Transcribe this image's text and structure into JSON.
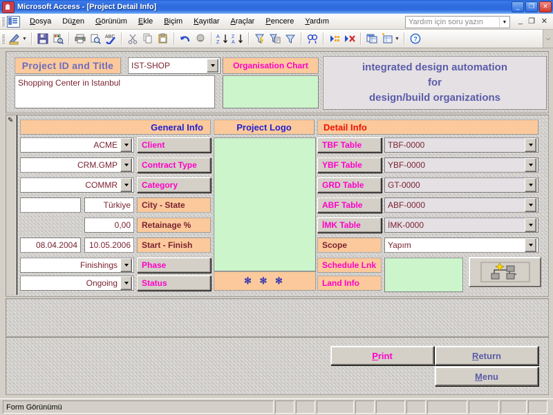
{
  "window": {
    "title": "Microsoft Access - [Project Detail Info]",
    "app_icon": "access-key-icon",
    "minimize": "_",
    "restore": "❐",
    "close": "✕"
  },
  "menubar": {
    "items": [
      {
        "label": "Dosya",
        "accel": "D"
      },
      {
        "label": "Düzen",
        "accel": "z"
      },
      {
        "label": "Görünüm",
        "accel": "G"
      },
      {
        "label": "Ekle",
        "accel": "E"
      },
      {
        "label": "Biçim",
        "accel": "B"
      },
      {
        "label": "Kayıtlar",
        "accel": "K"
      },
      {
        "label": "Araçlar",
        "accel": "A"
      },
      {
        "label": "Pencere",
        "accel": "P"
      },
      {
        "label": "Yardım",
        "accel": "Y"
      }
    ],
    "ask_box": {
      "placeholder": "Yardım için soru yazın",
      "value": "Yardım için soru yazın"
    },
    "doc_minimize": "_",
    "doc_restore": "❐",
    "doc_close": "✕"
  },
  "toolbar": {
    "buttons": [
      "view-design-icon",
      "view-dropdown-caret",
      "save-icon",
      "print-preview-icon",
      "print-icon",
      "preview-icon",
      "spelling-icon",
      "cut-icon",
      "copy-icon",
      "paste-icon",
      "undo-icon",
      "insert-hyperlink-icon",
      "sort-ascending-icon",
      "sort-descending-icon",
      "filter-by-selection-icon",
      "filter-by-form-icon",
      "apply-filter-icon",
      "find-icon",
      "new-record-icon",
      "delete-record-icon",
      "database-window-icon",
      "new-object-icon",
      "new-object-caret",
      "help-icon"
    ],
    "overflow": "⌵"
  },
  "form": {
    "header": {
      "title_label": "Project ID and Title",
      "project_id": "IST-SHOP",
      "org_chart_label": "Organisation Chart",
      "description": "Shopping Center in Istanbul",
      "tagline": [
        "integrated design automation",
        "for",
        "design/build organizations"
      ]
    },
    "sections": {
      "general_info": "General Info",
      "project_logo": "Project Logo",
      "detail_info": "Detail Info"
    },
    "general_rows": [
      {
        "value": "ACME",
        "label": "Client",
        "style": "raised",
        "dropdown": true,
        "pair": false
      },
      {
        "value": "CRM.GMP",
        "label": "Contract Type",
        "style": "raised",
        "dropdown": true,
        "pair": false
      },
      {
        "value": "COMMR",
        "label": "Category",
        "style": "raised",
        "dropdown": true,
        "pair": false
      },
      {
        "value": "Türkiye",
        "label": "City - State",
        "style": "orange",
        "dropdown": false,
        "pair": true,
        "pair_value": ""
      },
      {
        "value": "0,00",
        "label": "Retainage %",
        "style": "orange",
        "dropdown": false,
        "pair": false
      },
      {
        "value": "10.05.2006",
        "label": "Start - Finish",
        "style": "orange",
        "dropdown": false,
        "pair": true,
        "pair_value": "08.04.2004"
      },
      {
        "value": "Finishings",
        "label": "Phase",
        "style": "raised",
        "dropdown": true,
        "pair": false
      },
      {
        "value": "Ongoing",
        "label": "Status",
        "style": "raised",
        "dropdown": true,
        "pair": false
      }
    ],
    "logo": {
      "stars": "✻ ✻ ✻"
    },
    "detail_rows": [
      {
        "label": "TBF Table",
        "style": "raised",
        "value": "TBF-0000",
        "field": "combo-gray"
      },
      {
        "label": "YBF Table",
        "style": "raised",
        "value": "YBF-0000",
        "field": "combo-gray"
      },
      {
        "label": "GRD Table",
        "style": "raised",
        "value": "GT-0000",
        "field": "combo-gray"
      },
      {
        "label": "ABF Table",
        "style": "raised",
        "value": "ABF-0000",
        "field": "combo-gray"
      },
      {
        "label": "İMK Table",
        "style": "raised",
        "value": "İMK-0000",
        "field": "combo-gray"
      },
      {
        "label": "Scope",
        "style": "orange",
        "value": "Yapım",
        "field": "combo-white"
      },
      {
        "label": "Schedule Lnk",
        "style": "orange",
        "value": "",
        "field": "green"
      },
      {
        "label": "Land Info",
        "style": "orange",
        "value": "",
        "field": "green"
      }
    ],
    "org_button_icon": "org-chart-icon",
    "buttons": {
      "print": "Print",
      "print_accel": "P",
      "return": "Return",
      "return_accel": "R",
      "menu": "Menu",
      "menu_accel": "M"
    }
  },
  "statusbar": {
    "text": "Form Görünümü",
    "cells": [
      "",
      "",
      "",
      "",
      "",
      "",
      "",
      "",
      ""
    ]
  },
  "colors": {
    "orange": "#fbc99b",
    "green": "#ccf5cc",
    "magenta": "#ff00c8",
    "blue_label": "#2222cc",
    "red_label": "#ee1100",
    "dark_red_text": "#7a2230",
    "tagline_blue": "#5c5ca8",
    "face": "#d4d0c8"
  }
}
